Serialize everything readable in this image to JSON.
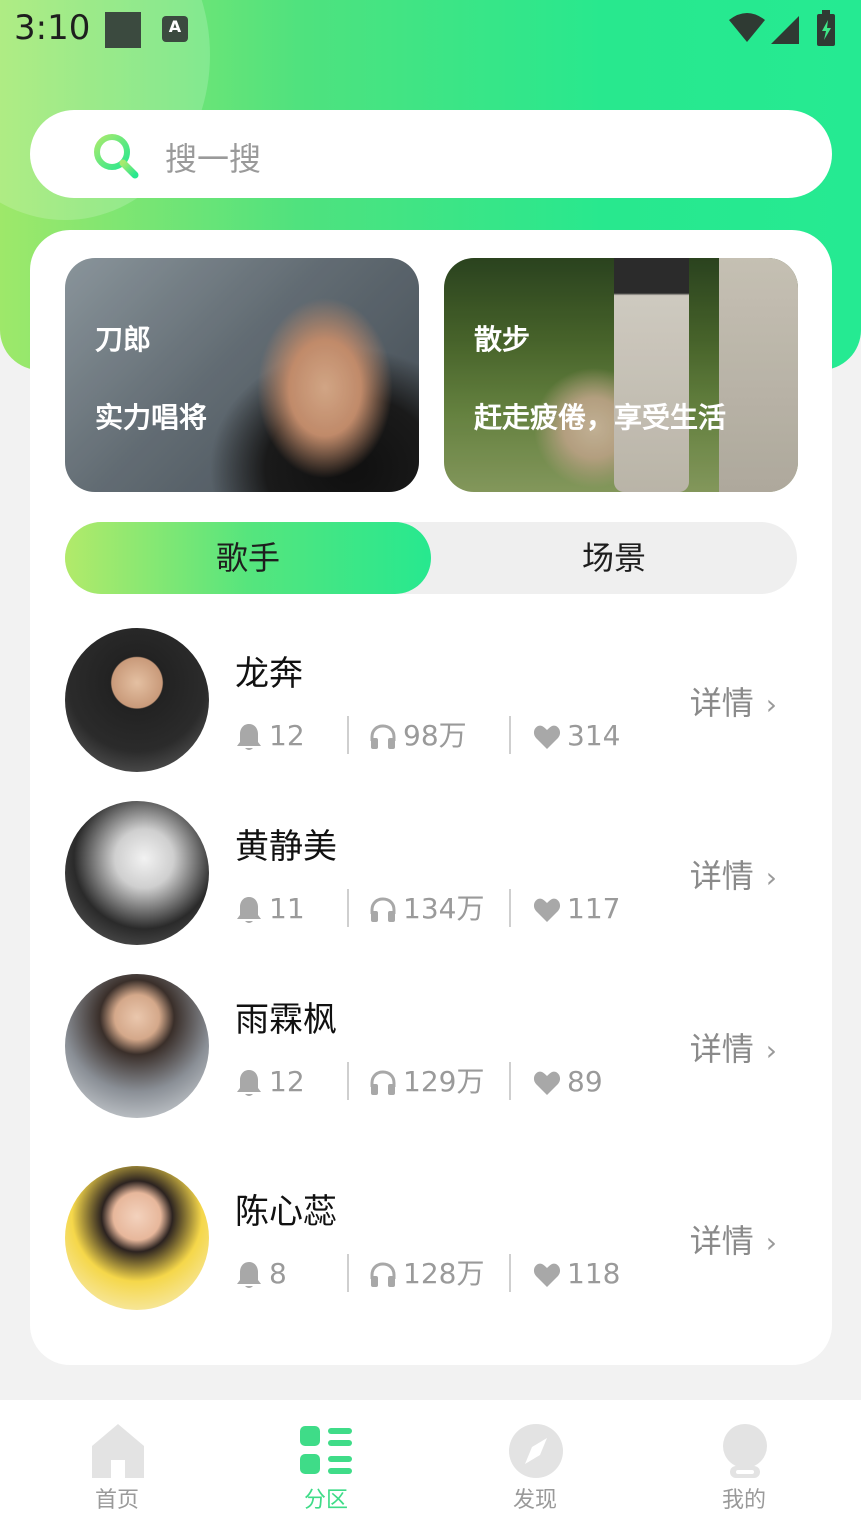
{
  "status_bar": {
    "time": "3:10",
    "a_label": "A"
  },
  "search": {
    "placeholder": "搜一搜"
  },
  "banners": [
    {
      "title": "刀郎",
      "subtitle": "实力唱将"
    },
    {
      "title": "散步",
      "subtitle": "赶走疲倦，享受生活"
    }
  ],
  "tabs": {
    "active": "歌手",
    "inactive": "场景"
  },
  "singers": [
    {
      "name": "龙奔",
      "count": "12",
      "plays": "98万",
      "likes": "314",
      "detail": "详情"
    },
    {
      "name": "黄静美",
      "count": "11",
      "plays": "134万",
      "likes": "117",
      "detail": "详情"
    },
    {
      "name": "雨霖枫",
      "count": "12",
      "plays": "129万",
      "likes": "89",
      "detail": "详情"
    },
    {
      "name": "陈心蕊",
      "count": "8",
      "plays": "128万",
      "likes": "118",
      "detail": "详情"
    }
  ],
  "nav": [
    {
      "label": "首页",
      "icon": "home-icon"
    },
    {
      "label": "分区",
      "icon": "category-icon"
    },
    {
      "label": "发现",
      "icon": "compass-icon"
    },
    {
      "label": "我的",
      "icon": "profile-icon"
    }
  ],
  "colors": {
    "accent": "#27e88f",
    "accent_light": "#b2ea6a",
    "nav_active": "#3fdc88"
  }
}
